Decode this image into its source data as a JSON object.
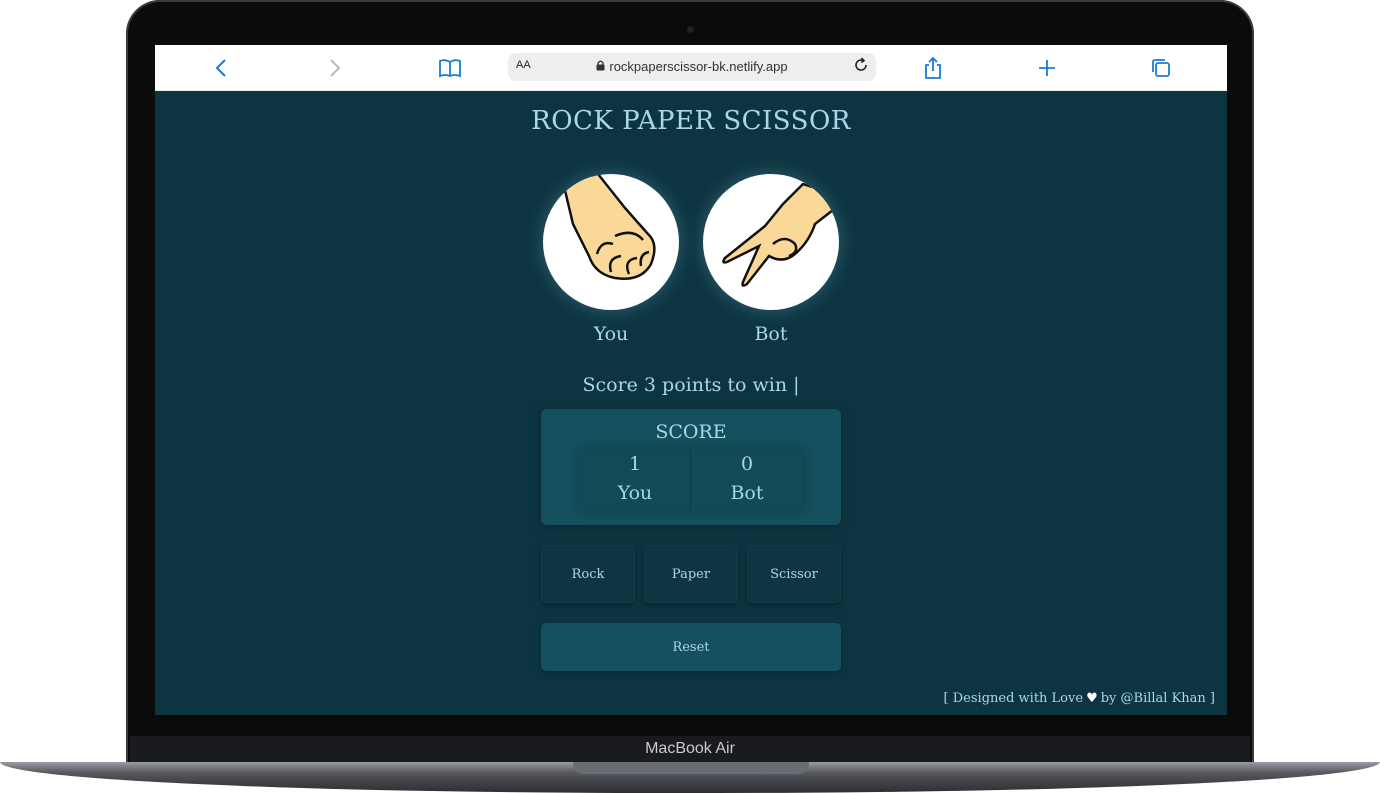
{
  "device": {
    "label": "MacBook Air"
  },
  "browser": {
    "text_size_label": "AA",
    "url": "rockpaperscissor-bk.netlify.app",
    "icons": [
      "chevron-left-icon",
      "chevron-right-icon",
      "book-icon",
      "lock-icon",
      "reload-icon",
      "share-icon",
      "plus-icon",
      "tabs-icon"
    ]
  },
  "app": {
    "title": "ROCK PAPER SCISSOR",
    "players": {
      "you": {
        "label": "You",
        "hand": "rock"
      },
      "bot": {
        "label": "Bot",
        "hand": "scissor"
      }
    },
    "win_text": "Score 3 points to win |",
    "score": {
      "title": "SCORE",
      "you": {
        "value": "1",
        "label": "You"
      },
      "bot": {
        "value": "0",
        "label": "Bot"
      }
    },
    "choices": [
      "Rock",
      "Paper",
      "Scissor"
    ],
    "reset_label": "Reset",
    "footer": {
      "before": "[ Designed with Love",
      "after": "by @Billal Khan ]"
    },
    "colors": {
      "background": "#0d3541",
      "panel": "#14505e",
      "text": "#a9d6ea",
      "accent": "#1a7bd9"
    }
  }
}
